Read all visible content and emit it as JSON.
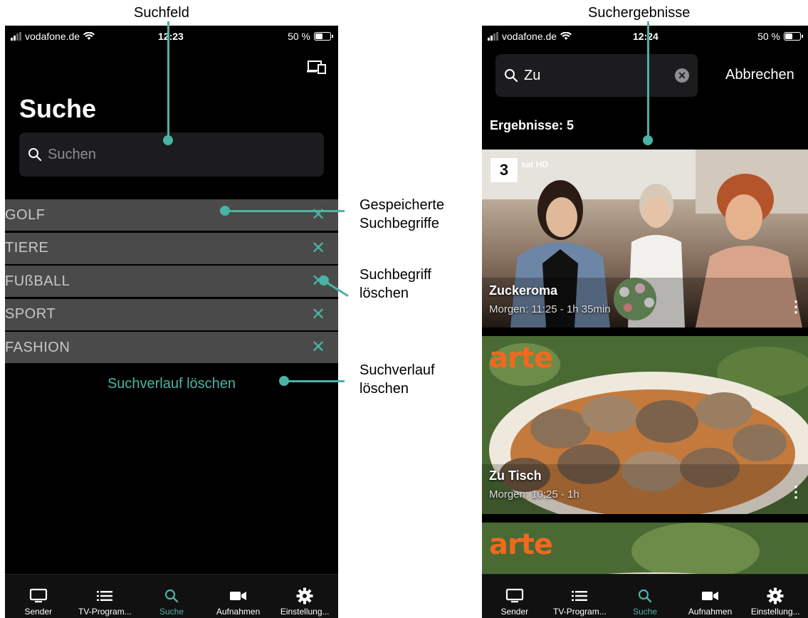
{
  "annotations": {
    "search_field": "Suchfeld",
    "search_results": "Suchergebnisse",
    "saved_terms": [
      "Gespeicherte",
      "Suchbegriffe"
    ],
    "delete_term": [
      "Suchbegriff",
      "löschen"
    ],
    "clear_history": [
      "Suchverlauf",
      "löschen"
    ]
  },
  "left_screen": {
    "status": {
      "carrier": "vodafone.de",
      "time": "12:23",
      "battery": "50 %"
    },
    "title": "Suche",
    "search_placeholder": "Suchen",
    "history": [
      "GOLF",
      "TIERE",
      "FUßBALL",
      "SPORT",
      "FASHION"
    ],
    "delete_symbol": "✕",
    "clear_history_label": "Suchverlauf löschen"
  },
  "right_screen": {
    "status": {
      "carrier": "vodafone.de",
      "time": "12:24",
      "battery": "50 %"
    },
    "search_value": "Zu",
    "cancel_label": "Abbrechen",
    "results_label": "Ergebnisse: 5",
    "results": [
      {
        "channel": "3sat HD",
        "channel_logo": "3",
        "channel_text": "sat HD",
        "title": "Zuckeroma",
        "time": "Morgen: 11:25 - 1h 35min"
      },
      {
        "channel": "arte",
        "title": "Zu Tisch",
        "time": "Morgen: 10:25 - 1h"
      },
      {
        "channel": "arte"
      }
    ]
  },
  "tabs": [
    "Sender",
    "TV-Program...",
    "Suche",
    "Aufnahmen",
    "Einstellung..."
  ],
  "colors": {
    "accent": "#4bb3a5",
    "background": "#000000",
    "history_row": "#4a4a4a"
  }
}
